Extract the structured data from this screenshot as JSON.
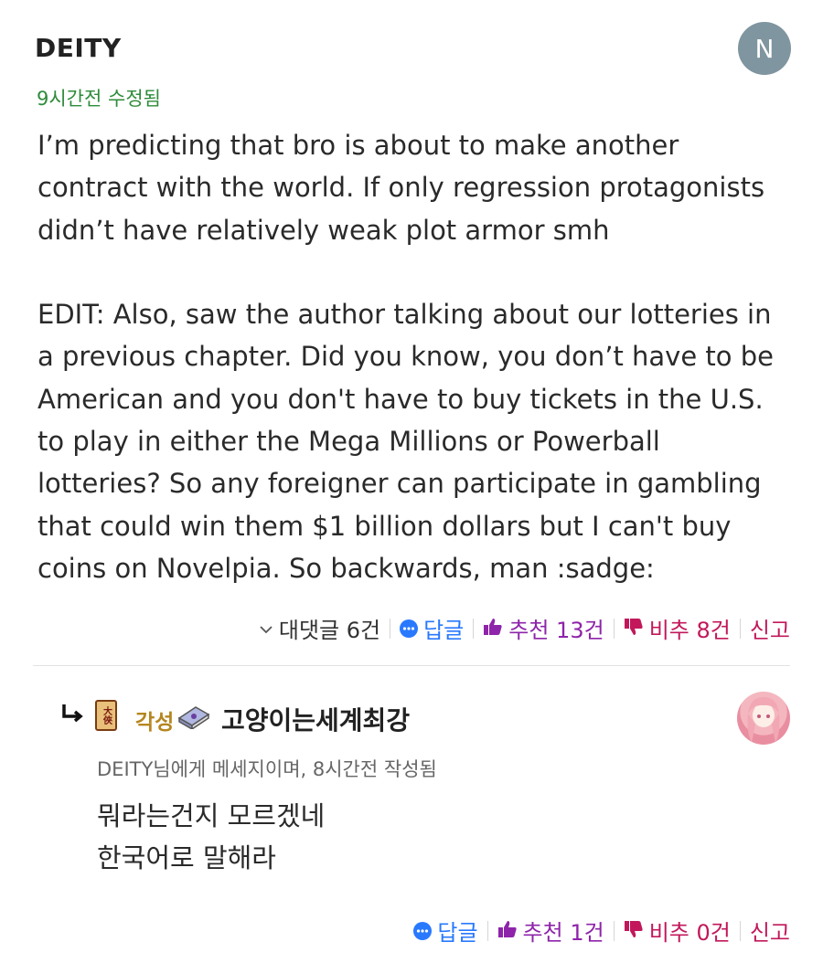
{
  "comment": {
    "author": "DEITY",
    "avatar_letter": "N",
    "meta": "9시간전 수정됨",
    "body": "I’m predicting that bro is about to make another\ncontract with the world. If only regression protagonists\ndidn’t have relatively weak plot armor smh\n\nEDIT: Also, saw the author talking about our lotteries in\na previous chapter. Did you know, you don’t have to be\nAmerican and you don't have to buy tickets in the U.S.\nto play in either the Mega Millions or Powerball\nlotteries? So any foreigner can participate in gambling\nthat could win them $1 billion dollars but I can't buy\ncoins on Novelpia. So backwards, man :sadge:",
    "actions": {
      "replies_label": "대댓글 6건",
      "reply_label": "답글",
      "upvote_label": "추천 13건",
      "downvote_label": "비추 8건",
      "report_label": "신고"
    }
  },
  "reply": {
    "rank_badge_text": "大俠",
    "rank_label": "각성",
    "author": "고양이는세계최강",
    "meta": "DEITY님에게 메세지이며, 8시간전 작성됨",
    "body": "뭐라는건지 모르겠네\n한국어로 말해라",
    "actions": {
      "reply_label": "답글",
      "upvote_label": "추천 1건",
      "downvote_label": "비추 0건",
      "report_label": "신고"
    }
  },
  "colors": {
    "meta_green": "#2e8b3a",
    "reply_blue": "#2979ff",
    "upvote_purple": "#8e24aa",
    "downvote_red": "#c2185b",
    "avatar_gray": "#7f959f"
  }
}
